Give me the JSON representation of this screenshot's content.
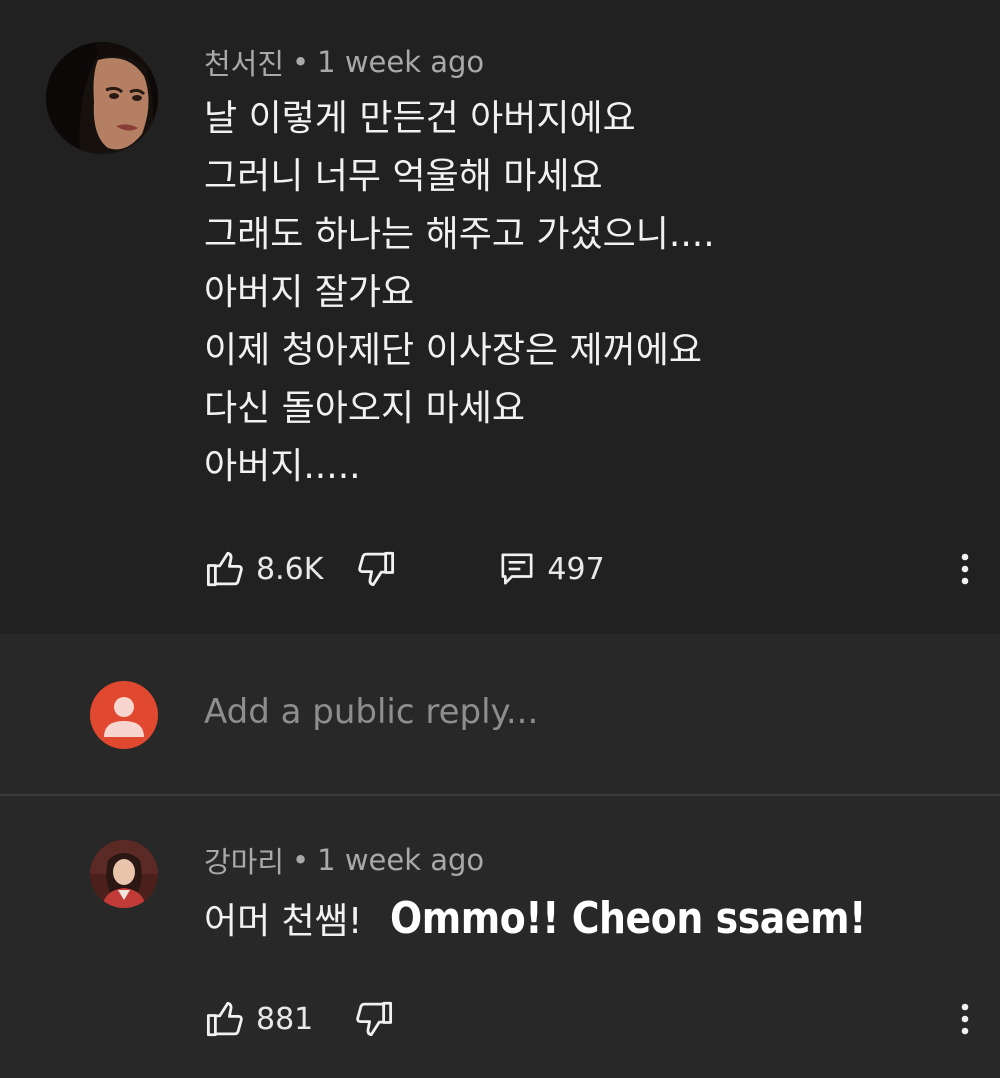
{
  "comment": {
    "author": "천서진",
    "separator": "•",
    "time": "1 week ago",
    "lines": [
      "날 이렇게 만든건 아버지에요",
      "그러니 너무 억울해 마세요",
      "그래도 하나는 해주고 가셨으니....",
      "아버지 잘가요",
      "이제 청아제단 이사장은 제꺼에요",
      "다신 돌아오지 마세요",
      "아버지....."
    ],
    "likes": "8.6K",
    "replies": "497"
  },
  "reply_box": {
    "placeholder": "Add a public reply..."
  },
  "reply": {
    "author": "강마리",
    "separator": "•",
    "time": "1 week ago",
    "text": "어머 천쌤!",
    "caption": "Ommo!!  Cheon ssaem!",
    "likes": "881"
  },
  "icons": {
    "like": "thumbs-up-icon",
    "dislike": "thumbs-down-icon",
    "reply": "comment-icon",
    "more": "more-vert-icon",
    "default_avatar": "person-icon"
  },
  "colors": {
    "background": "#212121",
    "reply_area": "#282828",
    "avatar_accent": "#e0492f",
    "text_primary": "#f1f1f1",
    "text_secondary": "#a9a9a9"
  }
}
